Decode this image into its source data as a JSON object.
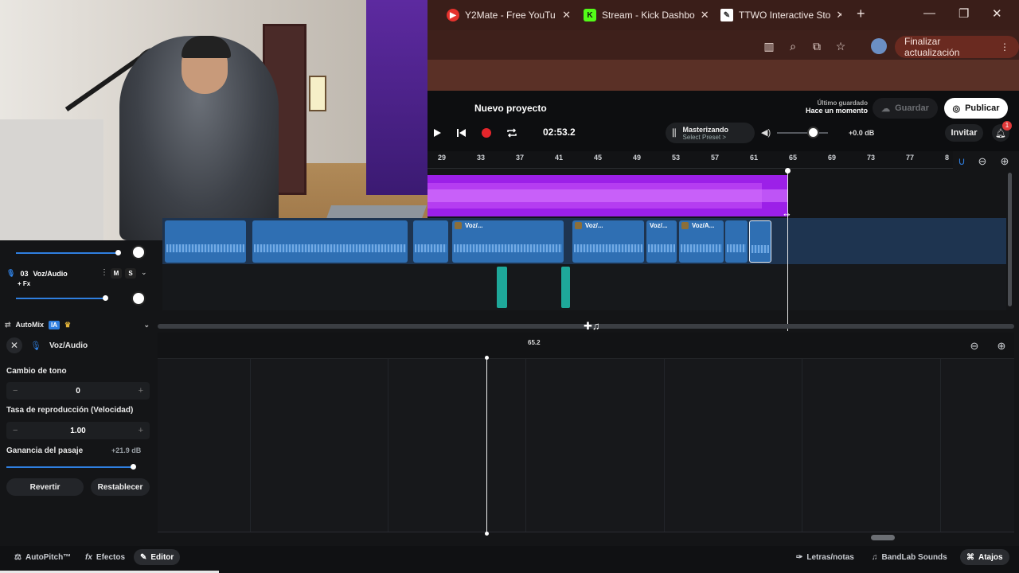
{
  "browser": {
    "tabs": [
      {
        "title": "Y2Mate - Free YouTu",
        "icon": "y2mate-icon",
        "color": "#e5322d"
      },
      {
        "title": "Stream - Kick Dashbo",
        "icon": "kick-icon",
        "color": "#53fc18"
      },
      {
        "title": "TTWO Interactive Sto",
        "icon": "ttwo-icon",
        "color": "#ffffff"
      }
    ],
    "new_tab": "+",
    "update_button": "Finalizar actualización"
  },
  "daw": {
    "project_title": "Nuevo proyecto",
    "timecode": "02:53.2",
    "mastering": {
      "title": "Masterizando",
      "subtitle": "Select Preset >"
    },
    "master_volume": "+0.0 dB",
    "last_saved_label": "Último guardado",
    "last_saved_value": "Hace un momento",
    "save_button": "Guardar",
    "publish_button": "Publicar",
    "invite_button": "Invitar",
    "notification_count": "1",
    "ruler_ticks": [
      "29",
      "33",
      "37",
      "41",
      "45",
      "49",
      "53",
      "57",
      "61",
      "65",
      "69",
      "73",
      "77",
      "8"
    ],
    "clip_labels": [
      "Voz/...",
      "Voz/...",
      "Voz/...",
      "Voz/A..."
    ],
    "track3": {
      "number": "03",
      "name": "Voz/Audio",
      "mute": "M",
      "solo": "S",
      "fx": "+ Fx"
    },
    "lower_position": "65.2"
  },
  "editor": {
    "automix": "AutoMix",
    "automix_badge": "IA",
    "track_name": "Voz/Audio",
    "pitch_label": "Cambio de tono",
    "pitch_value": "0",
    "speed_label": "Tasa de reproducción (Velocidad)",
    "speed_value": "1.00",
    "gain_label": "Ganancia del pasaje",
    "gain_value": "+21.9 dB",
    "revert_button": "Revertir",
    "reset_button": "Restablecer",
    "minus": "−",
    "plus": "+"
  },
  "bottom": {
    "autopitch": "AutoPitch™",
    "effects": "Efectos",
    "editor": "Editor",
    "lyrics": "Letras/notas",
    "sounds": "BandLab Sounds",
    "shortcuts": "Atajos"
  },
  "colors": {
    "accent": "#2f7fe0",
    "track_purple": "#9c20e8",
    "clip_blue": "#2f6fb3",
    "clip_teal": "#1ea89a",
    "browser_frame": "#3a1e19"
  }
}
